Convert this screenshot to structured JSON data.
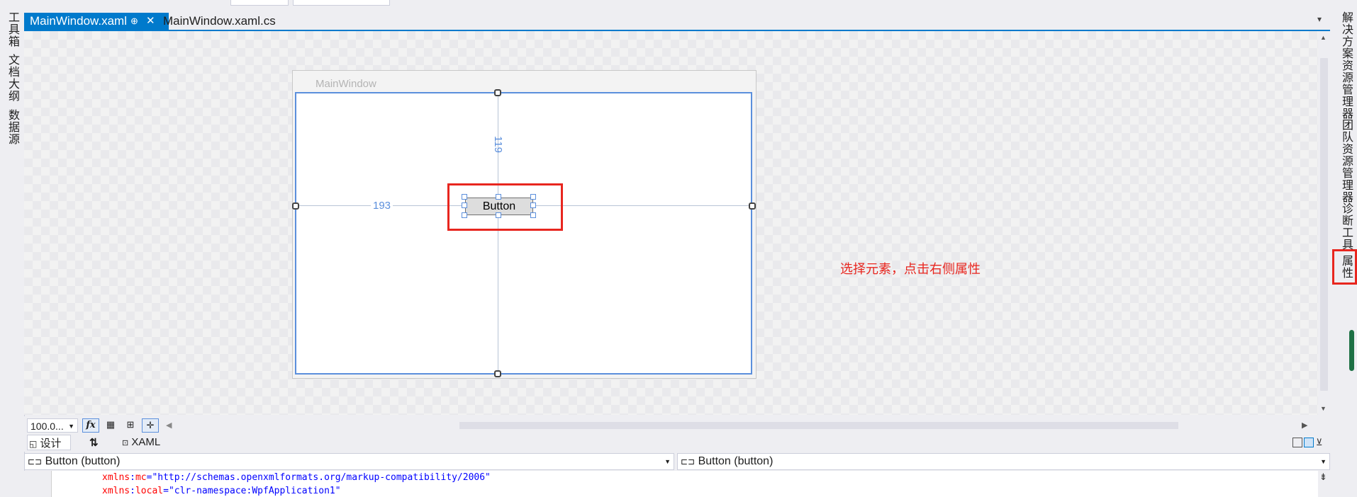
{
  "tabs": {
    "active": "MainWindow.xaml",
    "pin_glyph": "⊕",
    "close_glyph": "✕",
    "inactive": "MainWindow.xaml.cs",
    "overflow_glyph": "▾"
  },
  "left_strip": [
    "工具箱",
    "文档大纲",
    "数据源"
  ],
  "right_strip": [
    "解决方案资源管理器",
    "团队资源管理器",
    "诊断工具",
    "属性"
  ],
  "designer": {
    "window_title": "MainWindow",
    "margin_top": "119",
    "margin_left": "193",
    "button_text": "Button",
    "annotation": "选择元素，点击右侧属性"
  },
  "zoom_bar": {
    "zoom_value": "100.0...",
    "fx_label": "fx"
  },
  "split_tabs": {
    "design": "设计",
    "swap": "⇅",
    "xaml": "XAML"
  },
  "nav": {
    "left_dropdown": "Button (button)",
    "right_dropdown": "Button (button)"
  },
  "editor": {
    "line1_ns": "xmlns",
    "line1_prefix": "mc",
    "line1_value": "\"http://schemas.openxmlformats.org/markup-compatibility/2006\"",
    "line2_ns": "xmlns",
    "line2_prefix": "local",
    "line2_value": "\"clr-namespace:WpfApplication1\""
  },
  "colors": {
    "accent": "#007acc",
    "annotation_red": "#e8261f",
    "selection_blue": "#5b8fdc"
  }
}
